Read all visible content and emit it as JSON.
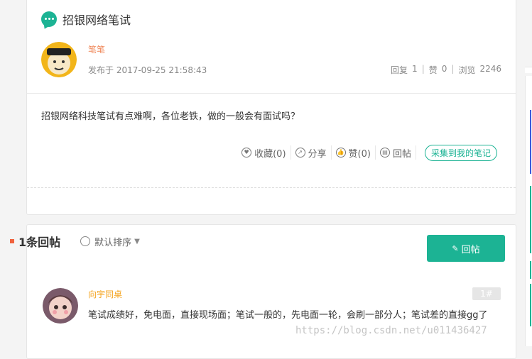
{
  "post": {
    "title": "招银网络笔试",
    "author": "笔笔",
    "publish_time": "发布于 2017-09-25 21:58:43",
    "stats": {
      "reply_label": "回复",
      "reply_count": "1",
      "like_label": "赞",
      "like_count": "0",
      "view_label": "浏览",
      "view_count": "2246"
    },
    "content": "招银网络科技笔试有点难啊，各位老铁，做的一般会有面试吗？",
    "actions": {
      "collect": "收藏(0)",
      "share": "分享",
      "like": "赞(0)",
      "reply": "回帖",
      "save_note": "采集到我的笔记"
    }
  },
  "replies_header": {
    "count": "1条回帖",
    "sort": "默认排序",
    "reply_button": "回帖"
  },
  "reply": {
    "author": "向宇同桌",
    "floor": "1#",
    "content": "笔试成绩好，免电面，直接现场面；笔试一般的，先电面一轮，会刷一部分人；笔试差的直接gg了"
  },
  "watermark": "https://blog.csdn.net/u011436427",
  "colors": {
    "accent": "#1cb394",
    "author_orange": "#f08a5d",
    "reply_author": "#f5a623",
    "marker_red": "#f0623e"
  }
}
